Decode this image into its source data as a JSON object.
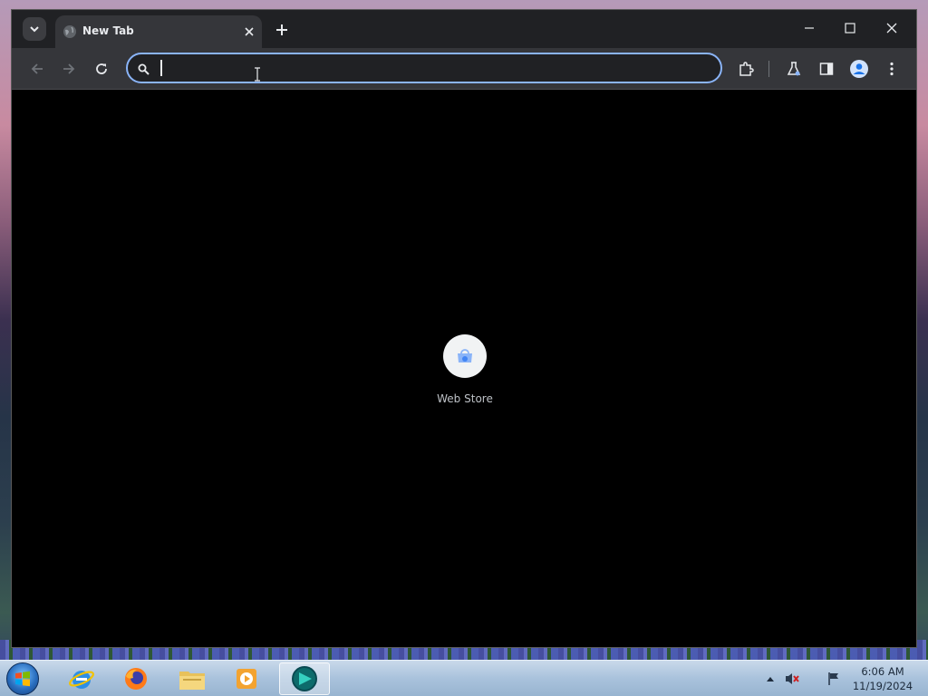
{
  "browser": {
    "tab": {
      "title": "New Tab"
    },
    "omnibox": {
      "value": "",
      "placeholder": ""
    }
  },
  "new_tab_page": {
    "shortcuts": [
      {
        "label": "Web Store",
        "icon": "web-store-icon"
      }
    ]
  },
  "taskbar": {
    "apps": [
      "internet-explorer-icon",
      "firefox-icon",
      "file-explorer-icon",
      "media-player-icon",
      "browser-icon"
    ],
    "clock": {
      "time": "6:06 AM",
      "date": "11/19/2024"
    }
  },
  "colors": {
    "accent": "#8ab4f8",
    "frame": "#202124",
    "toolbar": "#35363a",
    "content_bg": "#000000"
  }
}
